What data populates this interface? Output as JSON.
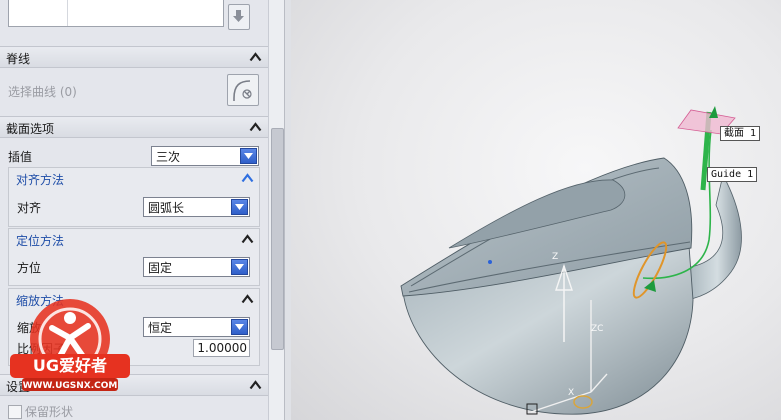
{
  "panel": {
    "spine_section": {
      "title": "脊线",
      "select_curve_label": "选择曲线 (0)"
    },
    "section_options": {
      "title": "截面选项",
      "interpolation": {
        "label": "插值",
        "value": "三次"
      },
      "alignment_method": {
        "title": "对齐方法",
        "align_label": "对齐",
        "align_value": "圆弧长"
      },
      "orientation_method": {
        "title": "定位方法",
        "orient_label": "方位",
        "orient_value": "固定"
      },
      "scaling_method": {
        "title": "缩放方法",
        "scale_label": "缩放",
        "scale_value": "恒定",
        "factor_label": "比例因子",
        "factor_value": "1.00000"
      }
    },
    "settings_section": {
      "title": "设置",
      "keep_shape_label": "保留形状"
    }
  },
  "watermark": {
    "brand": "UG爱好者",
    "url": "WWW.UGSNX.COM"
  },
  "viewport": {
    "labels": {
      "section": "截面 1",
      "guide": "Guide 1"
    },
    "axes": {
      "z": "Z",
      "zc": "ZC",
      "x": "X"
    }
  },
  "colors": {
    "accent_blue": "#1f4ea8",
    "dropdown_arrow": "#2f5fc9",
    "guide_green": "#2db44a",
    "section_orange": "#e0952a",
    "model_body": "#b7c2c8"
  }
}
